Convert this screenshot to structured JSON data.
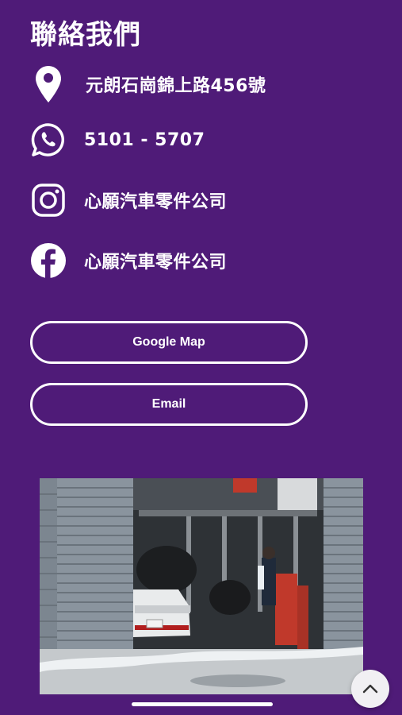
{
  "contact": {
    "title": "聯絡我們",
    "address": "元朗石崗錦上路456號",
    "phone": "5101 - 5707",
    "instagram": "心願汽車零件公司",
    "facebook": "心願汽車零件公司"
  },
  "buttons": {
    "google_map": "Google Map",
    "email": "Email"
  },
  "icons": {
    "location": "location-pin-icon",
    "whatsapp": "whatsapp-icon",
    "instagram": "instagram-icon",
    "facebook": "facebook-icon",
    "scroll_top": "chevron-up-icon"
  },
  "colors": {
    "background": "#4f1b78",
    "text": "#ffffff"
  }
}
